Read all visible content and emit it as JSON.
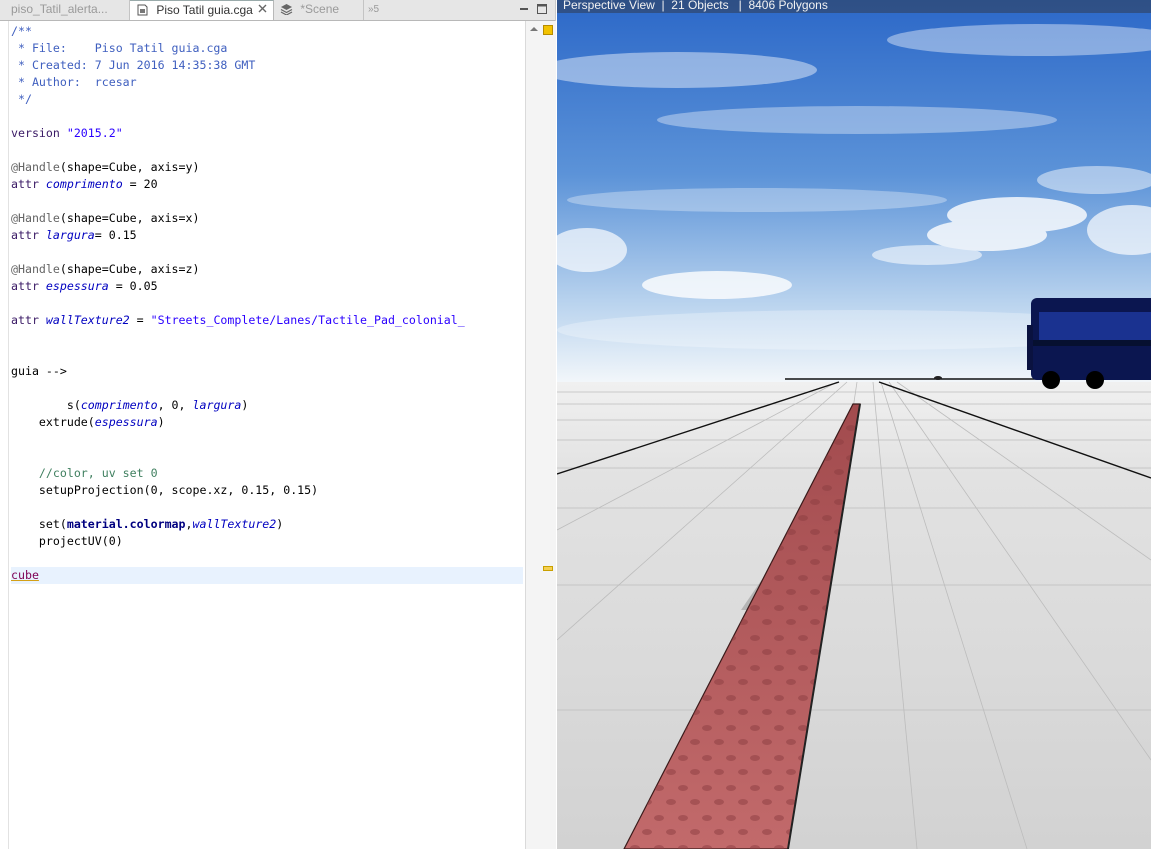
{
  "tabs": [
    {
      "label": "piso_Tatil_alerta...",
      "active": false,
      "icon": "file-icon"
    },
    {
      "label": "Piso Tatil guia.cga",
      "active": true,
      "icon": "cga-file-icon"
    },
    {
      "label": "*Scene",
      "active": false,
      "icon": "scene-layers-icon"
    },
    {
      "label": "»5",
      "active": false,
      "icon": "overflow-tabs-icon"
    }
  ],
  "editor": {
    "lines": [
      [
        {
          "t": "/**",
          "c": "doc"
        }
      ],
      [
        {
          "t": " * File:    Piso Tatil guia.cga",
          "c": "doc"
        }
      ],
      [
        {
          "t": " * Created: 7 Jun 2016 14:35:38 GMT",
          "c": "doc"
        }
      ],
      [
        {
          "t": " * Author:  rcesar",
          "c": "doc"
        }
      ],
      [
        {
          "t": " */",
          "c": "doc"
        }
      ],
      [],
      [
        {
          "t": "version ",
          "c": "kw"
        },
        {
          "t": "\"2015.2\"",
          "c": "str"
        }
      ],
      [],
      [
        {
          "t": "@Handle",
          "c": "ann"
        },
        {
          "t": "(shape=Cube, axis=y)",
          "c": "op"
        }
      ],
      [
        {
          "t": "attr ",
          "c": "kw"
        },
        {
          "t": "comprimento",
          "c": "var"
        },
        {
          "t": " = 20",
          "c": "op"
        }
      ],
      [],
      [
        {
          "t": "@Handle",
          "c": "ann"
        },
        {
          "t": "(shape=Cube, axis=x)",
          "c": "op"
        }
      ],
      [
        {
          "t": "attr ",
          "c": "kw"
        },
        {
          "t": "largura",
          "c": "var"
        },
        {
          "t": "= 0.15",
          "c": "op"
        }
      ],
      [],
      [
        {
          "t": "@Handle",
          "c": "ann"
        },
        {
          "t": "(shape=Cube, axis=z)",
          "c": "op"
        }
      ],
      [
        {
          "t": "attr ",
          "c": "kw"
        },
        {
          "t": "espessura",
          "c": "var"
        },
        {
          "t": " = 0.05",
          "c": "op"
        }
      ],
      [],
      [
        {
          "t": "attr ",
          "c": "kw"
        },
        {
          "t": "wallTexture2",
          "c": "var"
        },
        {
          "t": " = ",
          "c": "op"
        },
        {
          "t": "\"Streets_Complete/Lanes/Tactile_Pad_colonial_",
          "c": "str"
        }
      ],
      [],
      [],
      [
        {
          "t": "guia -->",
          "c": "op"
        }
      ],
      [],
      [
        {
          "t": "        s(",
          "c": "op"
        },
        {
          "t": "comprimento",
          "c": "var"
        },
        {
          "t": ", 0, ",
          "c": "op"
        },
        {
          "t": "largura",
          "c": "var"
        },
        {
          "t": ")",
          "c": "op"
        }
      ],
      [
        {
          "t": "    extrude(",
          "c": "op"
        },
        {
          "t": "espessura",
          "c": "var"
        },
        {
          "t": ")",
          "c": "op"
        }
      ],
      [],
      [],
      [
        {
          "t": "    ",
          "c": "op"
        },
        {
          "t": "//color, uv set 0",
          "c": "com"
        }
      ],
      [
        {
          "t": "    setupProjection(0, scope.xz, 0.15, 0.15)",
          "c": "op"
        }
      ],
      [],
      [
        {
          "t": "    set(",
          "c": "op"
        },
        {
          "t": "material.colormap",
          "c": "bold"
        },
        {
          "t": ",",
          "c": "op"
        },
        {
          "t": "wallTexture2",
          "c": "var"
        },
        {
          "t": ")",
          "c": "op"
        }
      ],
      [
        {
          "t": "    projectUV(0)",
          "c": "op"
        }
      ],
      [],
      [
        {
          "t": "cube",
          "c": "cube"
        }
      ]
    ],
    "current_line": 32
  },
  "viewport": {
    "view_name": "Perspective View",
    "objects": "21 Objects",
    "polygons": "8406 Polygons",
    "colors": {
      "sky_top": "#2f6fd0",
      "horizon": "#f4f8fb",
      "ground": "#dadada",
      "tactile_strip": "#b85f60",
      "bus": "#0c1a55"
    }
  }
}
